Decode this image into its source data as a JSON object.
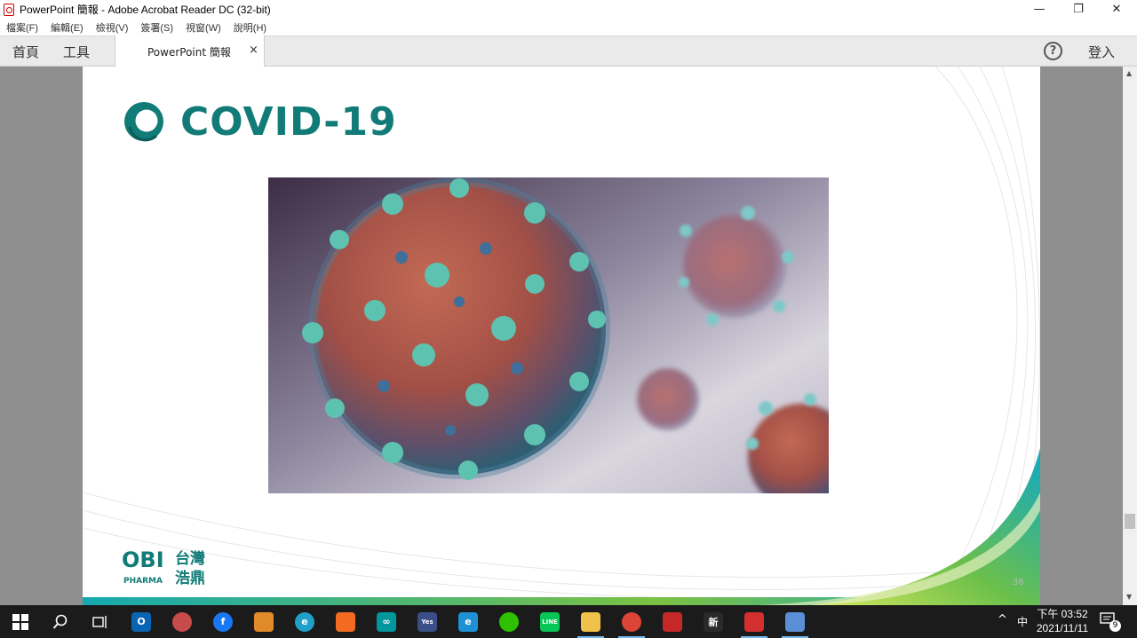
{
  "window": {
    "title": "PowerPoint 簡報 - Adobe Acrobat Reader DC (32-bit)",
    "minimize_glyph": "—",
    "restore_glyph": "❐",
    "close_glyph": "✕"
  },
  "menu": [
    "檔案(F)",
    "編輯(E)",
    "檢視(V)",
    "簽署(S)",
    "視窗(W)",
    "說明(H)"
  ],
  "tabs": {
    "home": "首頁",
    "tools": "工具",
    "document": "PowerPoint 簡報",
    "close_glyph": "×",
    "help_glyph": "?",
    "signin": "登入"
  },
  "slide": {
    "title": "COVID-19",
    "page_number": "36",
    "logo_text_en": "OBI",
    "logo_sub_en": "PHARMA",
    "logo_text_zh_1": "台灣",
    "logo_text_zh_2": "浩鼎",
    "accent_color": "#117b77"
  },
  "taskbar": {
    "apps": [
      {
        "name": "start-button",
        "icon": "windows-logo-icon"
      },
      {
        "name": "search-button",
        "icon": "search-icon"
      },
      {
        "name": "task-view-button",
        "icon": "task-view-icon"
      },
      {
        "name": "outlook-app",
        "icon": "outlook-icon",
        "text": "O",
        "color": "#0a64b4"
      },
      {
        "name": "app-bird",
        "icon": "bird-icon",
        "text": "",
        "color": "#c84b4b"
      },
      {
        "name": "facebook-app",
        "icon": "facebook-icon",
        "text": "f",
        "color": "#1877f2"
      },
      {
        "name": "app-color-circles",
        "icon": "color-circles-icon",
        "text": "",
        "color": "#e08a2a"
      },
      {
        "name": "edge-app",
        "icon": "edge-icon",
        "text": "e",
        "color": "#1fa0c8"
      },
      {
        "name": "app-orange",
        "icon": "orange-app-icon",
        "text": "",
        "color": "#f26b21"
      },
      {
        "name": "arduino-app",
        "icon": "arduino-icon",
        "text": "∞",
        "color": "#00979d"
      },
      {
        "name": "app-yes",
        "icon": "yes-icon",
        "text": "Yes",
        "color": "#3a4e88"
      },
      {
        "name": "ie-app",
        "icon": "internet-explorer-icon",
        "text": "e",
        "color": "#1e90d6"
      },
      {
        "name": "wechat-app",
        "icon": "wechat-icon",
        "text": "",
        "color": "#2dc100"
      },
      {
        "name": "line-app",
        "icon": "line-icon",
        "text": "LINE",
        "color": "#06c755"
      },
      {
        "name": "explorer-app",
        "icon": "folder-icon",
        "text": "",
        "color": "#f0c24b"
      },
      {
        "name": "chrome-app",
        "icon": "chrome-icon",
        "text": "",
        "color": "#db4437"
      },
      {
        "name": "app-red",
        "icon": "red-app-icon",
        "text": "",
        "color": "#c62828"
      },
      {
        "name": "app-news",
        "icon": "news-app-icon",
        "text": "新",
        "color": "#2a2a2a"
      },
      {
        "name": "acrobat-app",
        "icon": "acrobat-icon",
        "text": "",
        "color": "#d32f2f"
      },
      {
        "name": "app-paint",
        "icon": "paint-icon",
        "text": "",
        "color": "#5a8fd8"
      }
    ],
    "tray_caret": "^",
    "ime": "中",
    "time": "下午 03:52",
    "date": "2021/11/11",
    "notification_count": "9"
  }
}
